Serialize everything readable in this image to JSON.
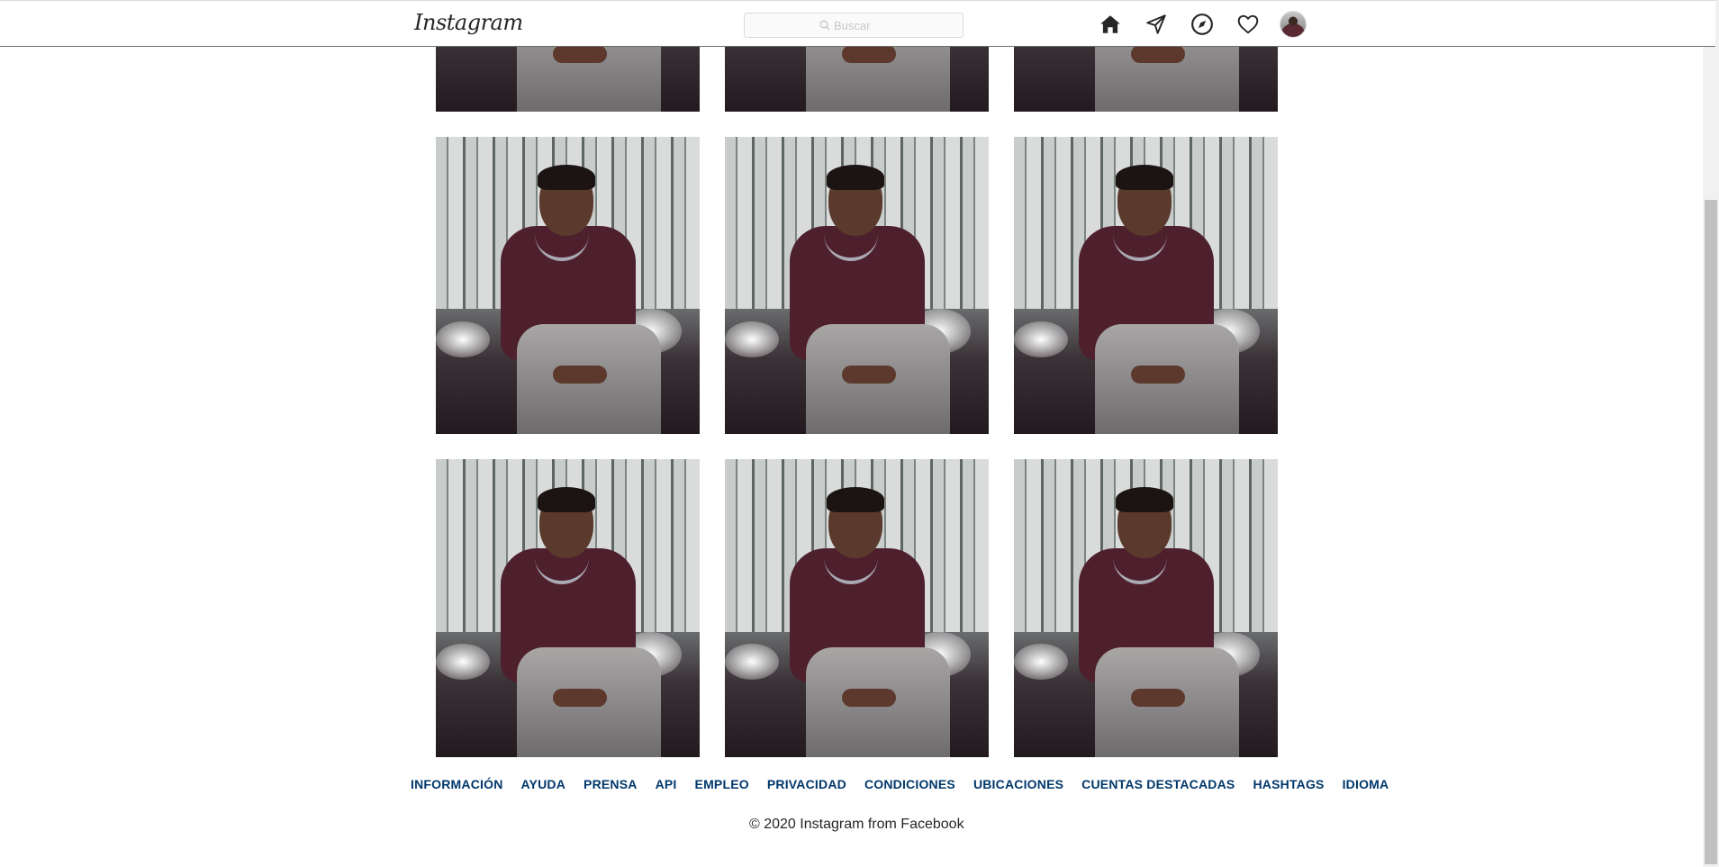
{
  "header": {
    "logo_text": "Instagram",
    "search": {
      "placeholder": "Buscar",
      "value": ""
    },
    "nav": [
      {
        "name": "home-icon"
      },
      {
        "name": "direct-icon"
      },
      {
        "name": "explore-icon"
      },
      {
        "name": "activity-heart-icon"
      },
      {
        "name": "profile-avatar"
      }
    ]
  },
  "grid": {
    "rows": 3,
    "columns": 3,
    "first_row_partially_visible": true
  },
  "footer": {
    "links": [
      "INFORMACIÓN",
      "AYUDA",
      "PRENSA",
      "API",
      "EMPLEO",
      "PRIVACIDAD",
      "CONDICIONES",
      "UBICACIONES",
      "CUENTAS DESTACADAS",
      "HASHTAGS",
      "IDIOMA"
    ],
    "copyright": "© 2020 Instagram from Facebook"
  },
  "colors": {
    "link": "#00376b",
    "text": "#262626",
    "border": "#dbdbdb"
  }
}
